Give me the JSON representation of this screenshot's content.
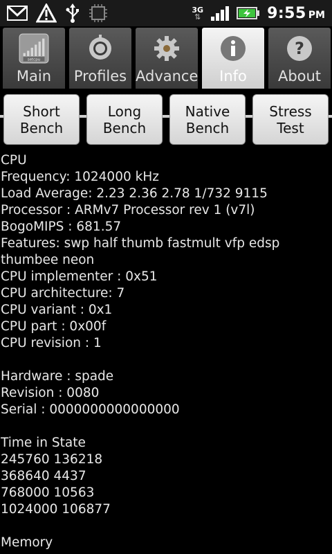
{
  "status_bar": {
    "network_type": "3G",
    "time": "9:55",
    "ampm": "PM"
  },
  "tabs": [
    {
      "label": "Main",
      "icon": "setcpu-icon",
      "icon_text": "setcpu"
    },
    {
      "label": "Profiles",
      "icon": "profiles-ring-icon"
    },
    {
      "label": "Advanced",
      "icon": "gear-icon"
    },
    {
      "label": "Info",
      "icon": "info-icon"
    },
    {
      "label": "About",
      "icon": "question-icon"
    }
  ],
  "active_tab": "Info",
  "buttons": {
    "short_bench": {
      "line1": "Short",
      "line2": "Bench"
    },
    "long_bench": {
      "line1": "Long",
      "line2": "Bench"
    },
    "native_bench": {
      "line1": "Native",
      "line2": "Bench"
    },
    "stress_test": {
      "line1": "Stress",
      "line2": "Test"
    }
  },
  "info": {
    "cpu_header": "CPU",
    "frequency": "Frequency: 1024000 kHz",
    "load_average": "Load Average: 2.23 2.36 2.78 1/732 9115",
    "processor": "Processor  : ARMv7 Processor rev 1 (v7l)",
    "bogomips": "BogoMIPS  : 681.57",
    "features": "Features: swp half thumb fastmult vfp edsp",
    "features_cont": "thumbee neon",
    "implementer": "CPU implementer    : 0x51",
    "architecture": "CPU architecture: 7",
    "variant": "CPU variant   : 0x1",
    "part": "CPU part    : 0x00f",
    "revision": "CPU revision : 1",
    "hardware": "Hardware  : spade",
    "board_revision": "Revision : 0080",
    "serial": "Serial      : 0000000000000000",
    "time_in_state_header": "Time in State",
    "tis": [
      "245760 136218",
      "368640 4437",
      "768000 10563",
      "1024000 106877"
    ],
    "memory_header": "Memory"
  },
  "colors": {
    "background": "#000000",
    "battery_green": "#3ec43e"
  }
}
